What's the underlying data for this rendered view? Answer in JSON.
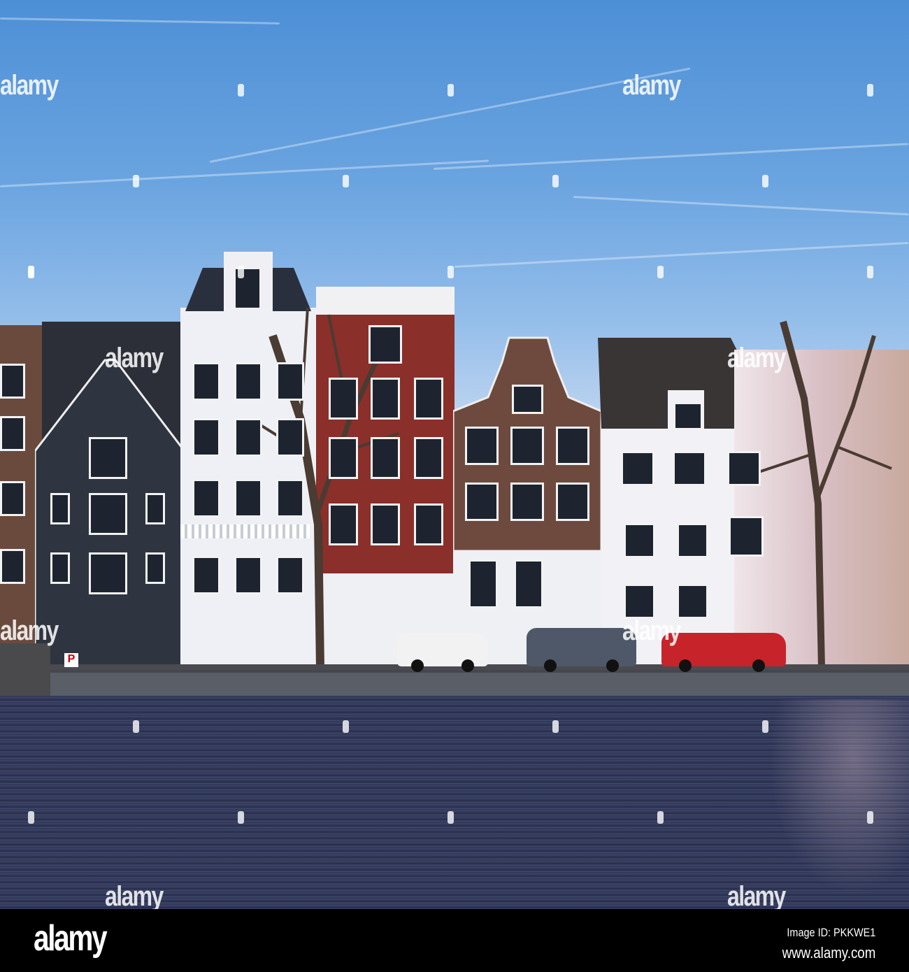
{
  "photo": {
    "subject": "Amsterdam canal houses",
    "colors": {
      "sky_top": "#4d8fd6",
      "sky_bottom": "#b9d2ef",
      "water": "#2f3656",
      "quay": "#5a5e66"
    },
    "watermark_text": "alamy",
    "parking_sign": "P"
  },
  "footer": {
    "logo": "alamy",
    "image_id": "Image ID: PKKWE1",
    "url": "www.alamy.com"
  }
}
